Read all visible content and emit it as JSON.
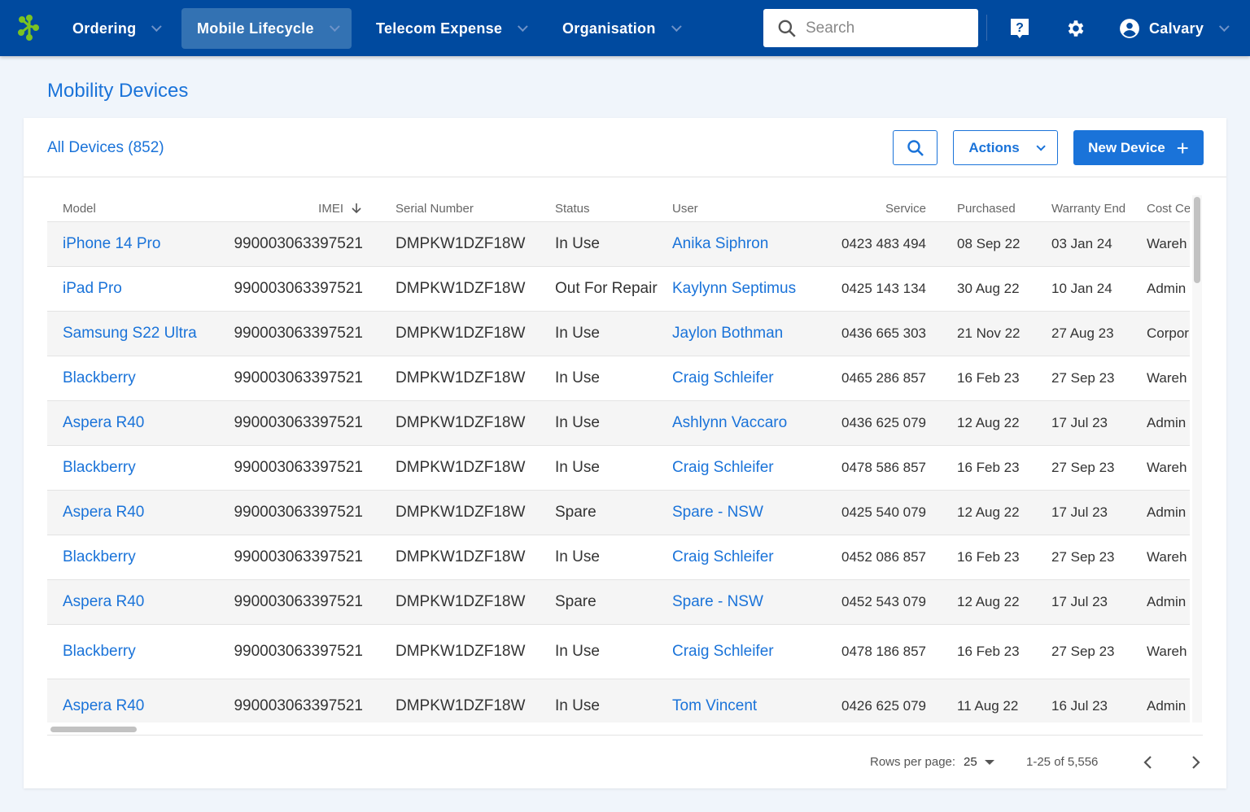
{
  "nav": {
    "items": [
      {
        "label": "Ordering"
      },
      {
        "label": "Mobile Lifecycle",
        "active": true
      },
      {
        "label": "Telecom Expense"
      },
      {
        "label": "Organisation"
      }
    ],
    "search_placeholder": "Search",
    "user": "Calvary",
    "brand_color": "#004a9f",
    "logo_color": "#7cc322"
  },
  "page": {
    "title": "Mobility Devices"
  },
  "card": {
    "count_label": "All Devices (852)",
    "actions_label": "Actions",
    "new_device_label": "New Device"
  },
  "table": {
    "columns": [
      "Model",
      "IMEI",
      "Serial Number",
      "Status",
      "User",
      "Service",
      "Purchased",
      "Warranty End",
      "Cost Ce"
    ],
    "sort": {
      "column": "IMEI",
      "direction": "descending"
    },
    "rows": [
      [
        "iPhone 14 Pro",
        "990003063397521",
        "DMPKW1DZF18W",
        "In Use",
        "Anika Siphron",
        "0423 483 494",
        "08 Sep 22",
        "03 Jan 24",
        "Wareh"
      ],
      [
        "iPad Pro",
        "990003063397521",
        "DMPKW1DZF18W",
        "Out For Repair",
        "Kaylynn Septimus",
        "0425 143 134",
        "30 Aug  22",
        "10 Jan 24",
        "Admin"
      ],
      [
        "Samsung S22 Ultra",
        "990003063397521",
        "DMPKW1DZF18W",
        "In Use",
        "Jaylon Bothman",
        "0436 665 303",
        "21 Nov 22",
        "27 Aug 23",
        "Corpor"
      ],
      [
        "Blackberry",
        "990003063397521",
        "DMPKW1DZF18W",
        "In Use",
        "Craig Schleifer",
        "0465 286 857",
        "16 Feb 23",
        "27 Sep 23",
        "Wareh"
      ],
      [
        "Aspera R40",
        "990003063397521",
        "DMPKW1DZF18W",
        "In Use",
        "Ashlynn Vaccaro",
        "0436 625 079",
        "12 Aug 22",
        "17 Jul 23",
        "Admin"
      ],
      [
        "Blackberry",
        "990003063397521",
        "DMPKW1DZF18W",
        "In Use",
        "Craig Schleifer",
        "0478 586 857",
        "16 Feb 23",
        "27 Sep 23",
        "Wareh"
      ],
      [
        "Aspera R40",
        "990003063397521",
        "DMPKW1DZF18W",
        "Spare",
        "Spare - NSW",
        "0425 540 079",
        "12 Aug 22",
        "17 Jul 23",
        "Admin"
      ],
      [
        "Blackberry",
        "990003063397521",
        "DMPKW1DZF18W",
        "In Use",
        "Craig Schleifer",
        "0452 086 857",
        "16 Feb 23",
        "27 Sep 23",
        "Wareh"
      ],
      [
        "Aspera R40",
        "990003063397521",
        "DMPKW1DZF18W",
        "Spare",
        "Spare - NSW",
        "0452 543 079",
        "12 Aug 22",
        "17 Jul 23",
        "Admin"
      ],
      [
        "Blackberry",
        "990003063397521",
        "DMPKW1DZF18W",
        "In Use",
        "Craig Schleifer",
        "0478 186 857",
        "16 Feb 23",
        "27 Sep 23",
        "Wareh"
      ],
      [
        "Aspera R40",
        "990003063397521",
        "DMPKW1DZF18W",
        "In Use",
        "Tom Vincent",
        "0426 625 079",
        "11 Aug 22",
        "16 Jul 23",
        "Admin"
      ]
    ]
  },
  "pagination": {
    "rows_per_page_label": "Rows per page:",
    "rows_per_page": "25",
    "range": "1-25 of 5,556"
  }
}
